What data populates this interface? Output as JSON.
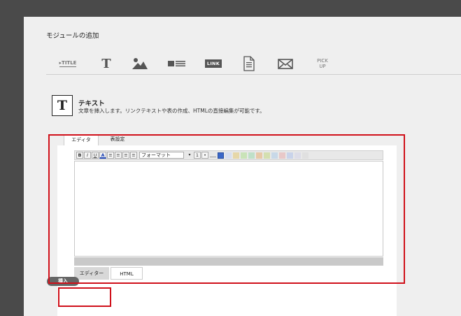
{
  "header": {
    "title": "モジュールの追加"
  },
  "tools": [
    {
      "name": "title",
      "label": "▸TITLE"
    },
    {
      "name": "text",
      "label": "T"
    },
    {
      "name": "image",
      "label": ""
    },
    {
      "name": "image-text",
      "label": ""
    },
    {
      "name": "link",
      "label": "LINK"
    },
    {
      "name": "document",
      "label": ""
    },
    {
      "name": "mail",
      "label": ""
    },
    {
      "name": "pickup",
      "label": "PICK\nUP"
    }
  ],
  "section": {
    "icon_letter": "T",
    "title": "テキスト",
    "description": "文章を挿入します。リンクテキストや表の作成、HTMLの直接編集が可能です。"
  },
  "tabs": {
    "editor": "エディタ",
    "table": "表設定"
  },
  "toolbar": {
    "bold": "B",
    "italic": "I",
    "underline": "U",
    "font_color": "A",
    "format": "フォーマット"
  },
  "mode_tabs": {
    "editor": "エディター",
    "html": "HTML"
  },
  "actions": {
    "insert": "挿入"
  }
}
